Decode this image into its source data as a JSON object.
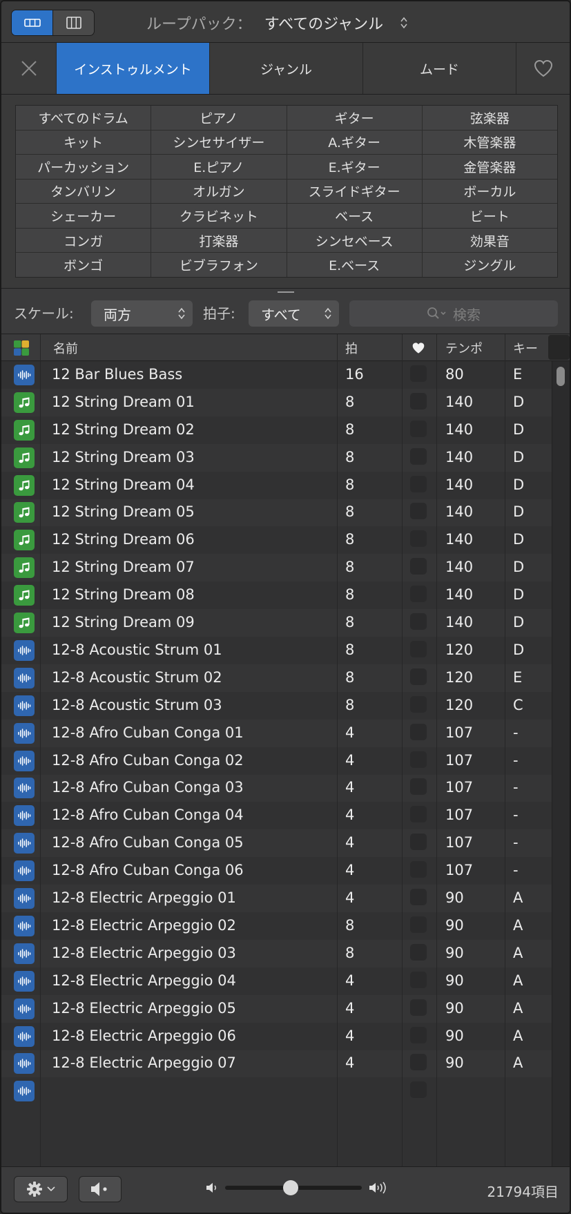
{
  "header": {
    "loop_pack_label": "ループパック：",
    "loop_pack_value": "すべてのジャンル"
  },
  "tabs": {
    "instrument": "インストゥルメント",
    "genre": "ジャンル",
    "mood": "ムード"
  },
  "instruments": [
    [
      "すべてのドラム",
      "ピアノ",
      "ギター",
      "弦楽器"
    ],
    [
      "キット",
      "シンセサイザー",
      "A.ギター",
      "木管楽器"
    ],
    [
      "パーカッション",
      "E.ピアノ",
      "E.ギター",
      "金管楽器"
    ],
    [
      "タンバリン",
      "オルガン",
      "スライドギター",
      "ボーカル"
    ],
    [
      "シェーカー",
      "クラビネット",
      "ベース",
      "ビート"
    ],
    [
      "コンガ",
      "打楽器",
      "シンセベース",
      "効果音"
    ],
    [
      "ボンゴ",
      "ビブラフォン",
      "E.ベース",
      "ジングル"
    ]
  ],
  "filters": {
    "scale_label": "スケール:",
    "scale_value": "両方",
    "beat_label": "拍子:",
    "beat_value": "すべて",
    "search_placeholder": "検索"
  },
  "table": {
    "columns": {
      "name": "名前",
      "beats": "拍",
      "tempo": "テンポ",
      "key": "キー"
    },
    "rows": [
      {
        "type": "audio",
        "name": "12 Bar Blues Bass",
        "beats": "16",
        "tempo": "80",
        "key": "E"
      },
      {
        "type": "midi",
        "name": "12 String Dream 01",
        "beats": "8",
        "tempo": "140",
        "key": "D"
      },
      {
        "type": "midi",
        "name": "12 String Dream 02",
        "beats": "8",
        "tempo": "140",
        "key": "D"
      },
      {
        "type": "midi",
        "name": "12 String Dream 03",
        "beats": "8",
        "tempo": "140",
        "key": "D"
      },
      {
        "type": "midi",
        "name": "12 String Dream 04",
        "beats": "8",
        "tempo": "140",
        "key": "D"
      },
      {
        "type": "midi",
        "name": "12 String Dream 05",
        "beats": "8",
        "tempo": "140",
        "key": "D"
      },
      {
        "type": "midi",
        "name": "12 String Dream 06",
        "beats": "8",
        "tempo": "140",
        "key": "D"
      },
      {
        "type": "midi",
        "name": "12 String Dream 07",
        "beats": "8",
        "tempo": "140",
        "key": "D"
      },
      {
        "type": "midi",
        "name": "12 String Dream 08",
        "beats": "8",
        "tempo": "140",
        "key": "D"
      },
      {
        "type": "midi",
        "name": "12 String Dream 09",
        "beats": "8",
        "tempo": "140",
        "key": "D"
      },
      {
        "type": "audio",
        "name": "12-8 Acoustic Strum 01",
        "beats": "8",
        "tempo": "120",
        "key": "D"
      },
      {
        "type": "audio",
        "name": "12-8 Acoustic Strum 02",
        "beats": "8",
        "tempo": "120",
        "key": "E"
      },
      {
        "type": "audio",
        "name": "12-8 Acoustic Strum 03",
        "beats": "8",
        "tempo": "120",
        "key": "C"
      },
      {
        "type": "audio",
        "name": "12-8 Afro Cuban Conga 01",
        "beats": "4",
        "tempo": "107",
        "key": "-"
      },
      {
        "type": "audio",
        "name": "12-8 Afro Cuban Conga 02",
        "beats": "4",
        "tempo": "107",
        "key": "-"
      },
      {
        "type": "audio",
        "name": "12-8 Afro Cuban Conga 03",
        "beats": "4",
        "tempo": "107",
        "key": "-"
      },
      {
        "type": "audio",
        "name": "12-8 Afro Cuban Conga 04",
        "beats": "4",
        "tempo": "107",
        "key": "-"
      },
      {
        "type": "audio",
        "name": "12-8 Afro Cuban Conga 05",
        "beats": "4",
        "tempo": "107",
        "key": "-"
      },
      {
        "type": "audio",
        "name": "12-8 Afro Cuban Conga 06",
        "beats": "4",
        "tempo": "107",
        "key": "-"
      },
      {
        "type": "audio",
        "name": "12-8 Electric Arpeggio 01",
        "beats": "4",
        "tempo": "90",
        "key": "A"
      },
      {
        "type": "audio",
        "name": "12-8 Electric Arpeggio 02",
        "beats": "8",
        "tempo": "90",
        "key": "A"
      },
      {
        "type": "audio",
        "name": "12-8 Electric Arpeggio 03",
        "beats": "8",
        "tempo": "90",
        "key": "A"
      },
      {
        "type": "audio",
        "name": "12-8 Electric Arpeggio 04",
        "beats": "4",
        "tempo": "90",
        "key": "A"
      },
      {
        "type": "audio",
        "name": "12-8 Electric Arpeggio 05",
        "beats": "4",
        "tempo": "90",
        "key": "A"
      },
      {
        "type": "audio",
        "name": "12-8 Electric Arpeggio 06",
        "beats": "4",
        "tempo": "90",
        "key": "A"
      },
      {
        "type": "audio",
        "name": "12-8 Electric Arpeggio 07",
        "beats": "4",
        "tempo": "90",
        "key": "A"
      },
      {
        "type": "audio",
        "name": "",
        "beats": "",
        "tempo": "",
        "key": ""
      }
    ]
  },
  "footer": {
    "item_count": "21794項目",
    "volume_level": 0.48
  },
  "colors": {
    "accent": "#2d73c8",
    "audio_icon": "#2f66b0",
    "midi_icon": "#3a9a3e"
  }
}
